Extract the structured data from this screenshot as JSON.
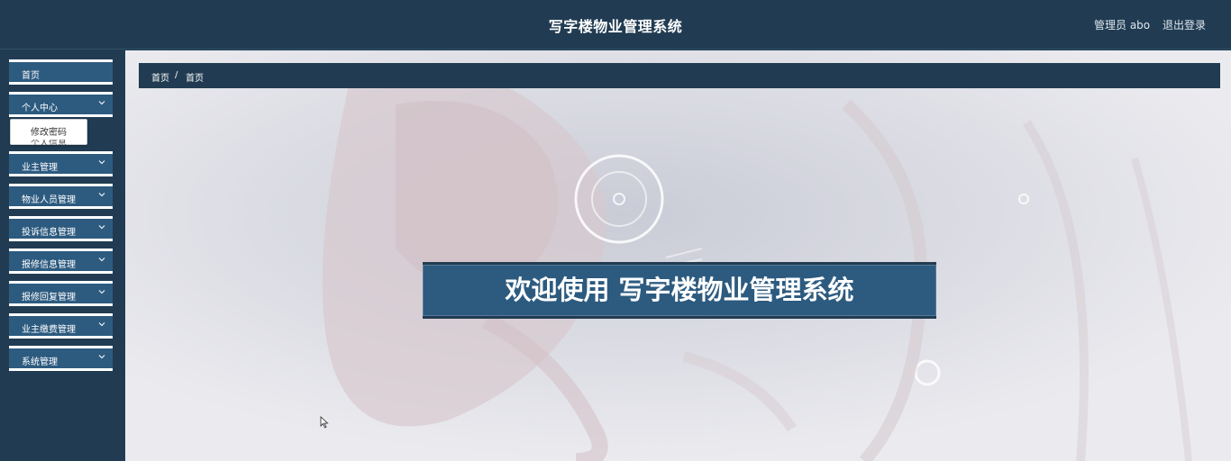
{
  "header": {
    "title": "写字楼物业管理系统",
    "user": "管理员 abo",
    "logout": "退出登录"
  },
  "sidebar": {
    "items": [
      {
        "label": "首页",
        "has_arrow": false
      },
      {
        "label": "个人中心",
        "has_arrow": true
      },
      {
        "label": "业主管理",
        "has_arrow": true
      },
      {
        "label": "物业人员管理",
        "has_arrow": true
      },
      {
        "label": "投诉信息管理",
        "has_arrow": true
      },
      {
        "label": "报修信息管理",
        "has_arrow": true
      },
      {
        "label": "报修回复管理",
        "has_arrow": true
      },
      {
        "label": "业主缴费管理",
        "has_arrow": true
      },
      {
        "label": "系统管理",
        "has_arrow": true
      }
    ],
    "submenu": {
      "item": "修改密码",
      "partially_hidden_item": "个人信息"
    }
  },
  "breadcrumb": {
    "home": "首页",
    "separator": "/",
    "current": "首页"
  },
  "welcome": "欢迎使用 写字楼物业管理系统",
  "colors": {
    "header_bg": "#213c52",
    "menu_item_bg": "#2d5b80",
    "content_bg": "#ebebef"
  }
}
